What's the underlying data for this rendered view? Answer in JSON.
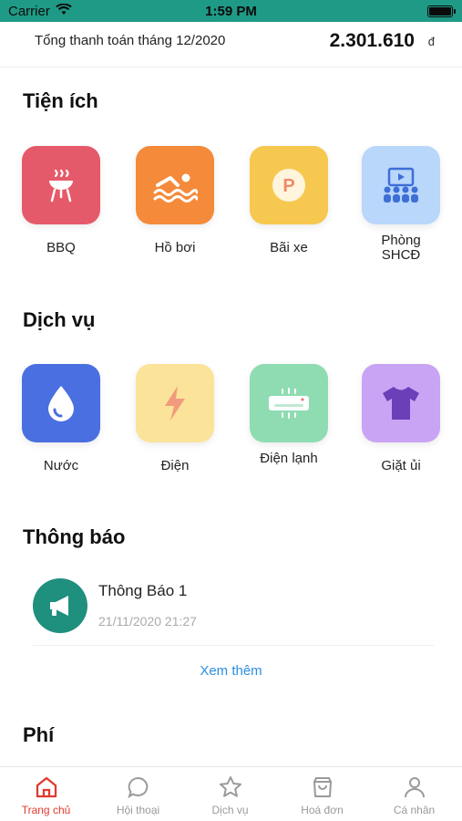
{
  "status_bar": {
    "carrier": "Carrier",
    "time": "1:59 PM"
  },
  "summary": {
    "label": "Tổng thanh toán tháng 12/2020",
    "amount": "2.301.610",
    "currency": "đ"
  },
  "utilities": {
    "title": "Tiện ích",
    "items": [
      {
        "label": "BBQ",
        "icon": "bbq-grill-icon",
        "color": "#e55a6a"
      },
      {
        "label": "Hồ bơi",
        "icon": "swimming-icon",
        "color": "#f48a3a"
      },
      {
        "label": "Bãi xe",
        "icon": "parking-icon",
        "color": "#f6c84f"
      },
      {
        "label": "Phòng SHCĐ",
        "icon": "community-room-icon",
        "color": "#b9d6fb"
      }
    ]
  },
  "services": {
    "title": "Dịch vụ",
    "items": [
      {
        "label": "Nước",
        "icon": "water-drop-icon",
        "color": "#4a6fe0"
      },
      {
        "label": "Điện",
        "icon": "lightning-icon",
        "color": "#fbe39a"
      },
      {
        "label": "Điện lạnh",
        "icon": "air-conditioner-icon",
        "color": "#8fdcb3"
      },
      {
        "label": "Giặt ủi",
        "icon": "tshirt-icon",
        "color": "#c9a4f5"
      }
    ]
  },
  "notifications": {
    "title": "Thông báo",
    "items": [
      {
        "title": "Thông Báo 1",
        "time": "21/11/2020 21:27"
      }
    ],
    "see_more": "Xem thêm"
  },
  "fees": {
    "title": "Phí"
  },
  "tabbar": {
    "tabs": [
      {
        "label": "Trang chủ",
        "icon": "home-icon",
        "active": true
      },
      {
        "label": "Hội thoại",
        "icon": "chat-icon",
        "active": false
      },
      {
        "label": "Dịch vụ",
        "icon": "star-icon",
        "active": false
      },
      {
        "label": "Hoá đơn",
        "icon": "shopping-bag-icon",
        "active": false
      },
      {
        "label": "Cá nhân",
        "icon": "user-icon",
        "active": false
      }
    ]
  },
  "colors": {
    "accent": "#1f9a86",
    "tab_active": "#e03a2f",
    "link": "#2a8fe0"
  }
}
